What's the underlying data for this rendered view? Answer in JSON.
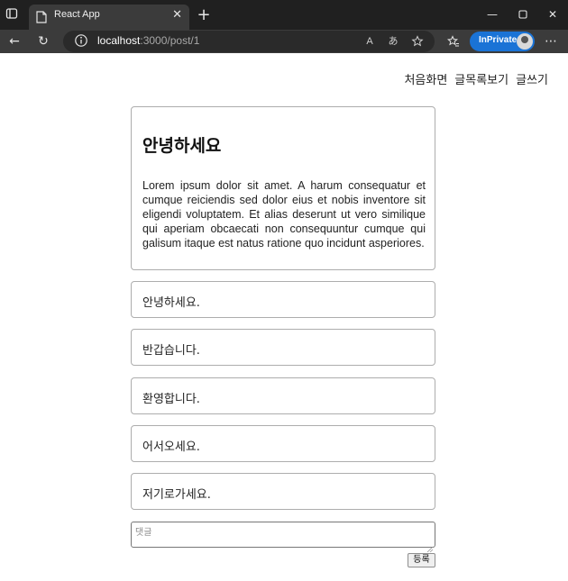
{
  "browser": {
    "tab_title": "React App",
    "url_host": "localhost",
    "url_path": ":3000/post/1",
    "inprivate_label": "InPrivate",
    "read_aloud_icon_text": "A",
    "translate_icon_text": "あ",
    "icons": [
      "tab-actions-icon",
      "page-icon",
      "close-icon",
      "plus-icon",
      "minimize-icon",
      "maximize-icon",
      "window-close-icon",
      "back-icon",
      "refresh-icon",
      "info-icon",
      "read-aloud-icon",
      "translate-icon",
      "add-favorite-icon",
      "favorites-icon",
      "more-icon"
    ]
  },
  "nav": {
    "home": "처음화면",
    "list": "글목록보기",
    "write": "글쓰기"
  },
  "post": {
    "title": "안녕하세요",
    "body": "Lorem ipsum dolor sit amet. A harum consequatur et cumque reiciendis sed dolor eius et nobis inventore sit eligendi voluptatem. Et alias deserunt ut vero similique qui aperiam obcaecati non consequuntur cumque qui galisum itaque est natus ratione quo incidunt asperiores."
  },
  "comments": [
    {
      "text": "안녕하세요."
    },
    {
      "text": "반갑습니다."
    },
    {
      "text": "환영합니다."
    },
    {
      "text": "어서오세요."
    },
    {
      "text": "저기로가세요."
    }
  ],
  "comment_form": {
    "placeholder": "댓글",
    "value": "",
    "submit_label": "등록"
  }
}
